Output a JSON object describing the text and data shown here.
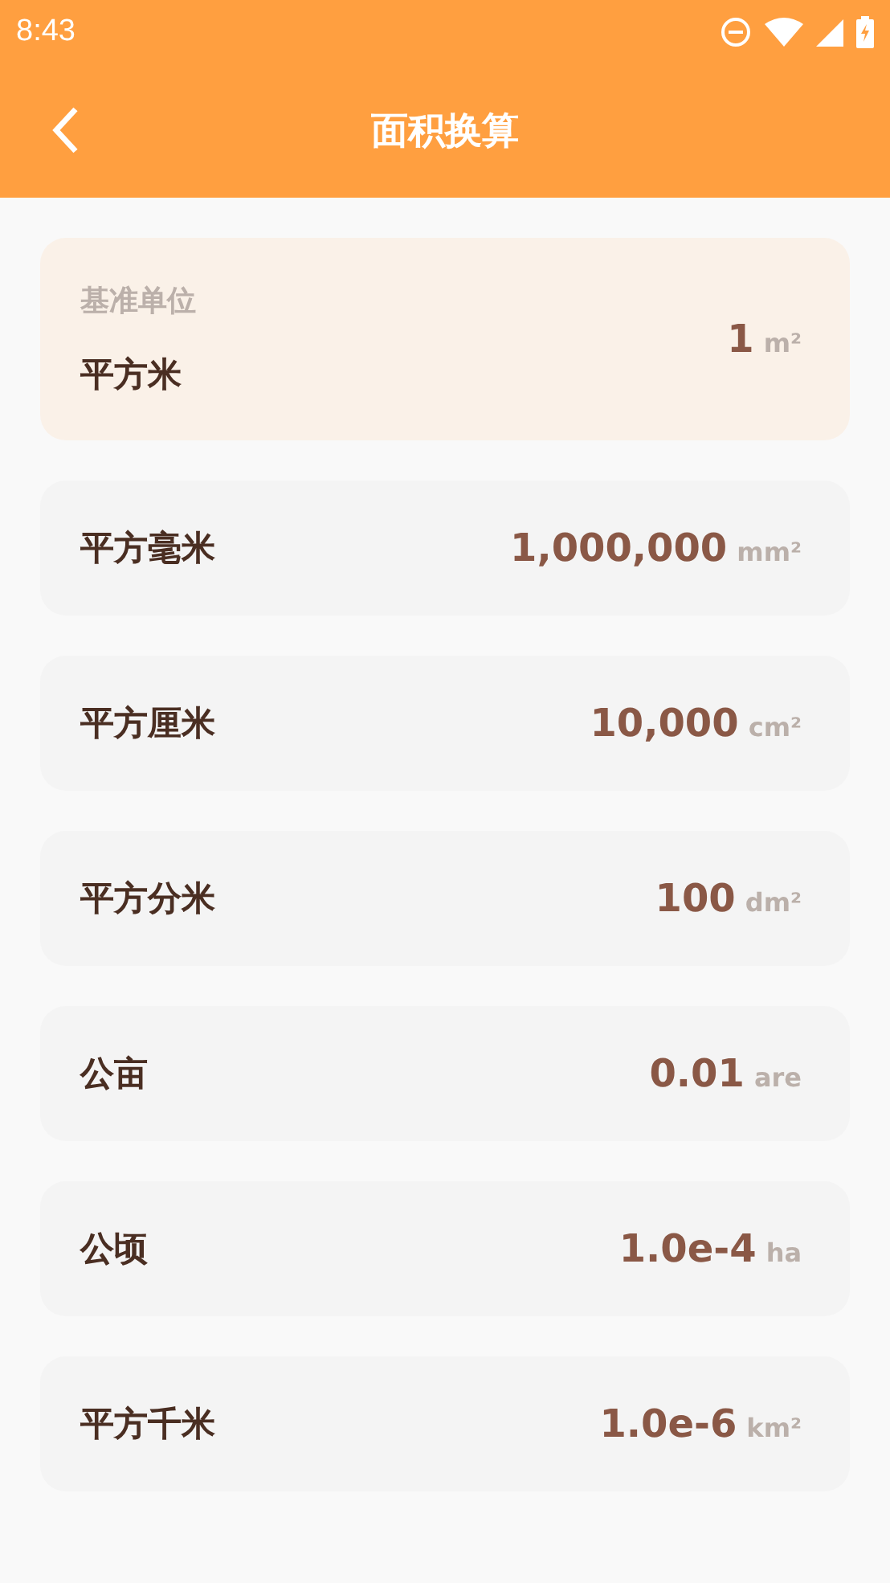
{
  "status_bar": {
    "time": "8:43"
  },
  "header": {
    "title": "面积换算"
  },
  "units": [
    {
      "kind": "base",
      "caption": "基准单位",
      "name": "平方米",
      "value": "1",
      "unit": "m²"
    },
    {
      "kind": "row",
      "name": "平方毫米",
      "value": "1,000,000",
      "unit": "mm²"
    },
    {
      "kind": "row",
      "name": "平方厘米",
      "value": "10,000",
      "unit": "cm²"
    },
    {
      "kind": "row",
      "name": "平方分米",
      "value": "100",
      "unit": "dm²"
    },
    {
      "kind": "row",
      "name": "公亩",
      "value": "0.01",
      "unit": "are"
    },
    {
      "kind": "row",
      "name": "公顷",
      "value": "1.0e-4",
      "unit": "ha"
    },
    {
      "kind": "row",
      "name": "平方千米",
      "value": "1.0e-6",
      "unit": "km²"
    }
  ]
}
